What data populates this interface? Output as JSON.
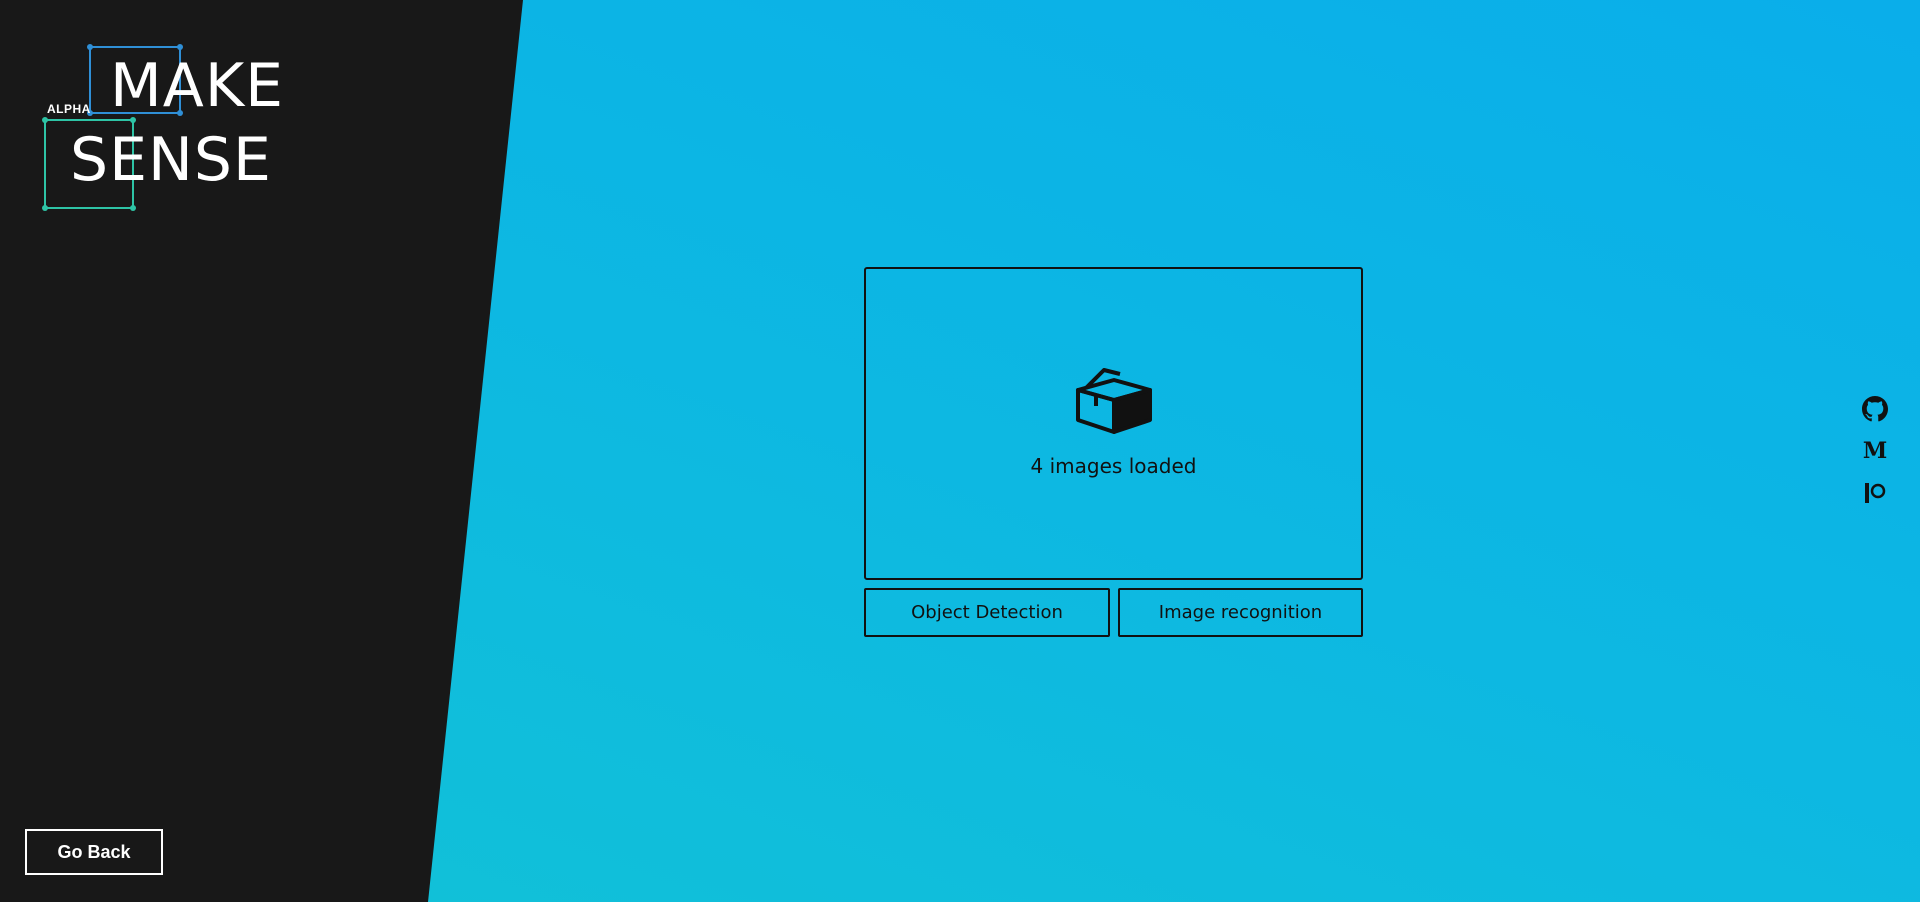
{
  "logo": {
    "alpha": "ALPHA",
    "make": "MAKE",
    "sense": "SENSE"
  },
  "navigation": {
    "go_back_label": "Go Back"
  },
  "drop_zone": {
    "icon": "box-icon",
    "status_text": "4 images loaded",
    "images_loaded": 4
  },
  "modes": {
    "object_detection_label": "Object Detection",
    "image_recognition_label": "Image recognition"
  },
  "social": {
    "items": [
      "github-icon",
      "medium-icon",
      "patreon-icon"
    ],
    "medium_glyph": "M"
  },
  "colors": {
    "dark_panel": "#181818",
    "background_start": "#0aaeea",
    "background_end": "#12c2d6",
    "logo_blue": "#2f8fd6",
    "logo_teal": "#2ec4a6",
    "text_dark": "#111111"
  }
}
